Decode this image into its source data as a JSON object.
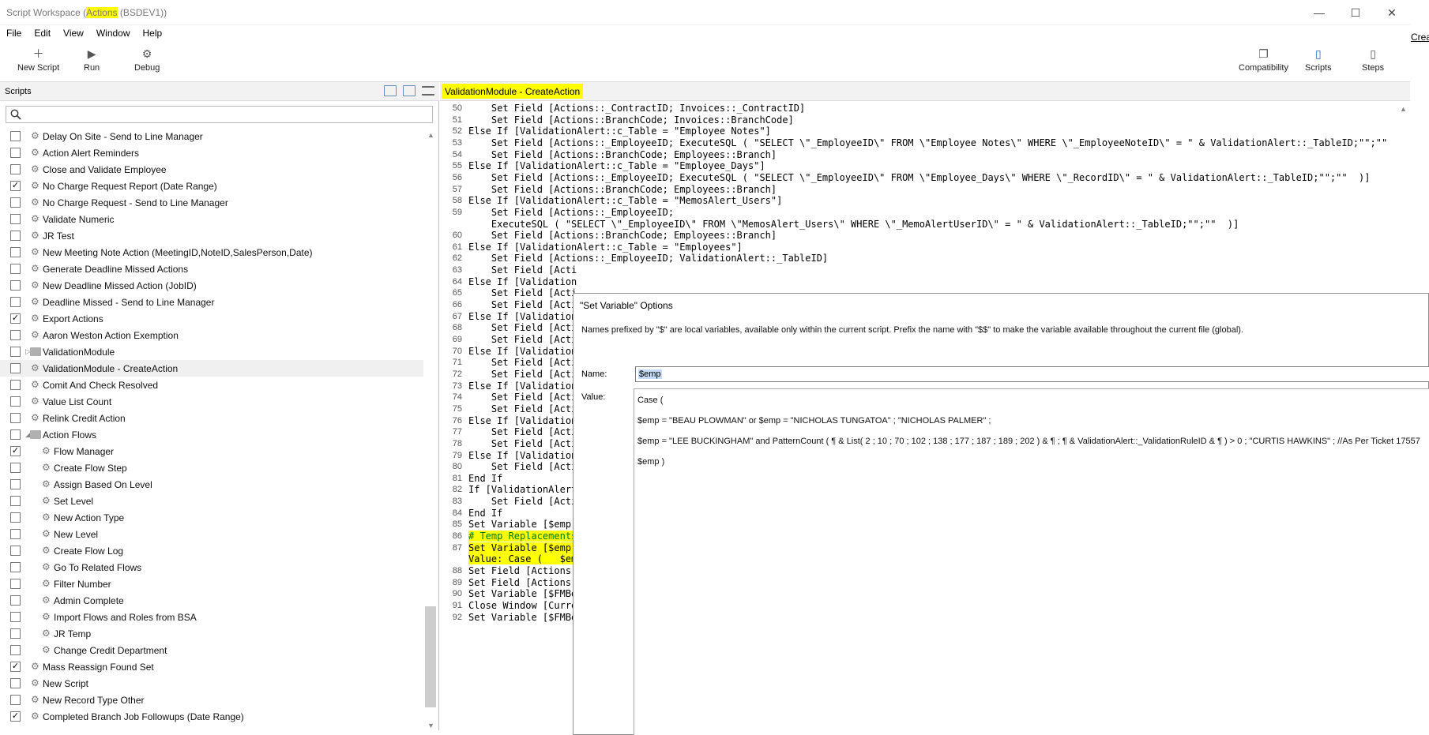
{
  "window": {
    "title_prefix": "Script Workspace (",
    "title_highlight": "Actions",
    "title_suffix": " (BSDEV1))",
    "minimize": "—",
    "maximize": "☐",
    "close": "✕"
  },
  "outside_text": "Crea",
  "menu": [
    "File",
    "Edit",
    "View",
    "Window",
    "Help"
  ],
  "toolbar": {
    "new_script": "New Script",
    "run": "Run",
    "debug": "Debug",
    "compatibility": "Compatibility",
    "scripts": "Scripts",
    "steps": "Steps"
  },
  "left": {
    "header": "Scripts",
    "search_placeholder": "",
    "items": [
      {
        "label": "Delay On Site - Send to Line Manager",
        "checked": false,
        "indent": 0,
        "type": "script"
      },
      {
        "label": "Action Alert Reminders",
        "checked": false,
        "indent": 0,
        "type": "script"
      },
      {
        "label": "Close and Validate Employee",
        "checked": false,
        "indent": 0,
        "type": "script"
      },
      {
        "label": "No Charge Request Report (Date Range)",
        "checked": true,
        "indent": 0,
        "type": "script"
      },
      {
        "label": "No Charge Request - Send to Line Manager",
        "checked": false,
        "indent": 0,
        "type": "script"
      },
      {
        "label": "Validate Numeric",
        "checked": false,
        "indent": 0,
        "type": "script"
      },
      {
        "label": "JR Test",
        "checked": false,
        "indent": 0,
        "type": "script"
      },
      {
        "label": "New Meeting Note Action (MeetingID,NoteID,SalesPerson,Date)",
        "checked": false,
        "indent": 0,
        "type": "script"
      },
      {
        "label": "Generate Deadline Missed Actions",
        "checked": false,
        "indent": 0,
        "type": "script"
      },
      {
        "label": "New Deadline Missed Action (JobID)",
        "checked": false,
        "indent": 0,
        "type": "script"
      },
      {
        "label": "Deadline Missed - Send to Line Manager",
        "checked": false,
        "indent": 0,
        "type": "script"
      },
      {
        "label": "Export Actions",
        "checked": true,
        "indent": 0,
        "type": "script"
      },
      {
        "label": "Aaron Weston Action Exemption",
        "checked": false,
        "indent": 0,
        "type": "script"
      },
      {
        "label": "ValidationModule",
        "checked": false,
        "indent": 0,
        "type": "folder",
        "expander": "▷"
      },
      {
        "label": "ValidationModule - CreateAction",
        "checked": false,
        "indent": 0,
        "type": "script",
        "selected": true
      },
      {
        "label": "Comit And Check Resolved",
        "checked": false,
        "indent": 0,
        "type": "script"
      },
      {
        "label": "Value List Count",
        "checked": false,
        "indent": 0,
        "type": "script"
      },
      {
        "label": "Relink Credit Action",
        "checked": false,
        "indent": 0,
        "type": "script"
      },
      {
        "label": "Action Flows",
        "checked": false,
        "indent": 0,
        "type": "folder",
        "expander": "◢"
      },
      {
        "label": "Flow Manager",
        "checked": true,
        "indent": 1,
        "type": "script"
      },
      {
        "label": "Create Flow Step",
        "checked": false,
        "indent": 1,
        "type": "script"
      },
      {
        "label": "Assign Based On Level",
        "checked": false,
        "indent": 1,
        "type": "script"
      },
      {
        "label": "Set Level",
        "checked": false,
        "indent": 1,
        "type": "script"
      },
      {
        "label": "New Action Type",
        "checked": false,
        "indent": 1,
        "type": "script"
      },
      {
        "label": "New Level",
        "checked": false,
        "indent": 1,
        "type": "script"
      },
      {
        "label": "Create Flow Log",
        "checked": false,
        "indent": 1,
        "type": "script"
      },
      {
        "label": "Go To Related Flows",
        "checked": false,
        "indent": 1,
        "type": "script"
      },
      {
        "label": "Filter Number",
        "checked": false,
        "indent": 1,
        "type": "script"
      },
      {
        "label": "Admin Complete",
        "checked": false,
        "indent": 1,
        "type": "script"
      },
      {
        "label": "Import Flows and Roles from BSA",
        "checked": false,
        "indent": 1,
        "type": "script"
      },
      {
        "label": "JR Temp",
        "checked": false,
        "indent": 1,
        "type": "script"
      },
      {
        "label": "Change Credit Department",
        "checked": false,
        "indent": 1,
        "type": "script"
      },
      {
        "label": "Mass Reassign Found Set",
        "checked": true,
        "indent": 0,
        "type": "script"
      },
      {
        "label": "New Script",
        "checked": false,
        "indent": 0,
        "type": "script"
      },
      {
        "label": "New Record Type Other",
        "checked": false,
        "indent": 0,
        "type": "script"
      },
      {
        "label": "Completed Branch Job Followups (Date Range)",
        "checked": true,
        "indent": 0,
        "type": "script"
      }
    ]
  },
  "editor": {
    "tab_title": "ValidationModule - CreateAction",
    "lines": [
      {
        "n": "50",
        "text": "    Set Field [Actions::_ContractID; Invoices::_ContractID]"
      },
      {
        "n": "51",
        "text": "    Set Field [Actions::BranchCode; Invoices::BranchCode]"
      },
      {
        "n": "52",
        "text": "Else If [ValidationAlert::c_Table = \"Employee Notes\"]"
      },
      {
        "n": "53",
        "text": "    Set Field [Actions::_EmployeeID; ExecuteSQL ( \"SELECT \\\"_EmployeeID\\\" FROM \\\"Employee Notes\\\" WHERE \\\"_EmployeeNoteID\\\" = \" & ValidationAlert::_TableID;\"\";\"\"  )]"
      },
      {
        "n": "54",
        "text": "    Set Field [Actions::BranchCode; Employees::Branch]"
      },
      {
        "n": "55",
        "text": "Else If [ValidationAlert::c_Table = \"Employee_Days\"]"
      },
      {
        "n": "56",
        "text": "    Set Field [Actions::_EmployeeID; ExecuteSQL ( \"SELECT \\\"_EmployeeID\\\" FROM \\\"Employee_Days\\\" WHERE \\\"_RecordID\\\" = \" & ValidationAlert::_TableID;\"\";\"\"  )]"
      },
      {
        "n": "57",
        "text": "    Set Field [Actions::BranchCode; Employees::Branch]"
      },
      {
        "n": "58",
        "text": "Else If [ValidationAlert::c_Table = \"MemosAlert_Users\"]"
      },
      {
        "n": "59",
        "text": "    Set Field [Actions::_EmployeeID;"
      },
      {
        "n": "",
        "text": "    ExecuteSQL ( \"SELECT \\\"_EmployeeID\\\" FROM \\\"MemosAlert_Users\\\" WHERE \\\"_MemoAlertUserID\\\" = \" & ValidationAlert::_TableID;\"\";\"\"  )]"
      },
      {
        "n": "60",
        "text": "    Set Field [Actions::BranchCode; Employees::Branch]"
      },
      {
        "n": "61",
        "text": "Else If [ValidationAlert::c_Table = \"Employees\"]"
      },
      {
        "n": "62",
        "text": "    Set Field [Actions::_EmployeeID; ValidationAlert::_TableID]"
      },
      {
        "n": "63",
        "text": "    Set Field [Acti"
      },
      {
        "n": "64",
        "text": "Else If [Validation"
      },
      {
        "n": "65",
        "text": "    Set Field [Acti"
      },
      {
        "n": "66",
        "text": "    Set Field [Acti"
      },
      {
        "n": "67",
        "text": "Else If [Validation"
      },
      {
        "n": "68",
        "text": "    Set Field [Acti"
      },
      {
        "n": "69",
        "text": "    Set Field [Acti"
      },
      {
        "n": "70",
        "text": "Else If [Validation"
      },
      {
        "n": "71",
        "text": "    Set Field [Acti"
      },
      {
        "n": "72",
        "text": "    Set Field [Acti"
      },
      {
        "n": "73",
        "text": "Else If [Validation"
      },
      {
        "n": "74",
        "text": "    Set Field [Acti"
      },
      {
        "n": "75",
        "text": "    Set Field [Acti"
      },
      {
        "n": "76",
        "text": "Else If [Validation"
      },
      {
        "n": "77",
        "text": "    Set Field [Acti"
      },
      {
        "n": "78",
        "text": "    Set Field [Acti"
      },
      {
        "n": "79",
        "text": "Else If [Validation"
      },
      {
        "n": "80",
        "text": "    Set Field [Acti"
      },
      {
        "n": "81",
        "text": "End If"
      },
      {
        "n": "82",
        "text": "If [ValidationAlert"
      },
      {
        "n": "83",
        "text": "    Set Field [Acti"
      },
      {
        "n": "84",
        "text": "End If"
      },
      {
        "n": "85",
        "text": "Set Variable [$emp;"
      },
      {
        "n": "86",
        "text": "# Temp Replacements",
        "highlight": true,
        "comment": true
      },
      {
        "n": "87",
        "text": "Set Variable [$emp;",
        "highlight": true
      },
      {
        "n": "",
        "text": "Value: Case (   $em",
        "highlight": true
      },
      {
        "n": "88",
        "text": "Set Field [Actions:"
      },
      {
        "n": "89",
        "text": "Set Field [Actions:"
      },
      {
        "n": "90",
        "text": "Set Variable [$FMBe"
      },
      {
        "n": "91",
        "text": "Close Window [Curre"
      },
      {
        "n": "92",
        "text": "Set Variable [$FMBe"
      }
    ]
  },
  "dialog": {
    "title": "\"Set Variable\" Options",
    "description": "Names prefixed by \"$\" are local variables, available only within the current script. Prefix the name with \"$$\" to make the variable available throughout the current file (global).",
    "name_label": "Name:",
    "name_value": "$emp",
    "value_label": "Value:",
    "value_lines": [
      "Case (",
      "$emp =  \"BEAU PLOWMAN\" or $emp = \"NICHOLAS TUNGATOA\" ; \"NICHOLAS PALMER\" ;",
      "$emp = \"LEE BUCKINGHAM\" and PatternCount ( ¶ & List( 2 ; 10 ; 70 ; 102 ; 138 ; 177 ; 187 ; 189 ; 202 ) & ¶ ; ¶ & ValidationAlert::_ValidationRuleID & ¶ ) > 0 ; \"CURTIS HAWKINS\" ; //As Per Ticket 17557",
      "$emp )"
    ]
  }
}
